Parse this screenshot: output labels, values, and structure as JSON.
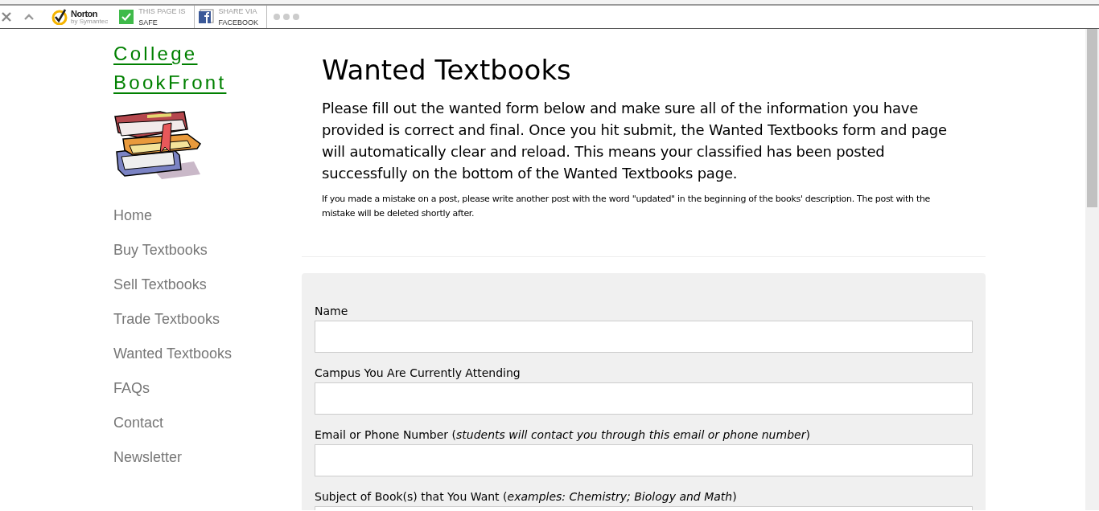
{
  "toolbar": {
    "norton": {
      "brand": "Norton",
      "by": "by Symantec"
    },
    "safe": {
      "line1": "THIS PAGE IS",
      "line2": "SAFE",
      "checked": true
    },
    "share": {
      "line1": "SHARE VIA",
      "line2": "FACEBOOK"
    }
  },
  "sidebar": {
    "site_title": [
      "College",
      "BookFront"
    ],
    "nav": [
      {
        "label": "Home"
      },
      {
        "label": "Buy Textbooks"
      },
      {
        "label": "Sell Textbooks"
      },
      {
        "label": "Trade Textbooks"
      },
      {
        "label": "Wanted Textbooks"
      },
      {
        "label": "FAQs"
      },
      {
        "label": "Contact"
      },
      {
        "label": "Newsletter"
      }
    ]
  },
  "main": {
    "title": "Wanted Textbooks",
    "intro": "Please fill out the wanted form below and make sure all of the information you have provided is correct and final. Once you hit submit, the Wanted Textbooks form and page will automatically clear and reload. This means your classified has been posted successfully on the bottom of the Wanted Textbooks page.",
    "note": "If you made a mistake on a post, please write another post with the word \"updated\" in the beginning of the books' description. The post with the mistake will be deleted shortly after."
  },
  "form": {
    "fields": [
      {
        "label": "Name"
      },
      {
        "label": "Campus You Are Currently Attending"
      },
      {
        "label": "Email or Phone Number (*students will contact you through this email or phone number*)"
      },
      {
        "label": "Subject of Book(s) that You Want (*examples: Chemistry; Biology and Math*)"
      }
    ]
  }
}
